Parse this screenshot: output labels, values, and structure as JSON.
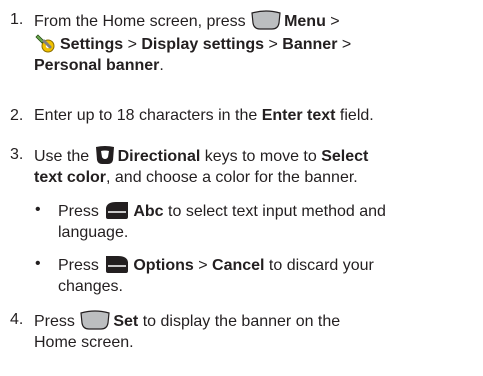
{
  "steps": [
    {
      "num": "1.",
      "a": "From the Home screen, press ",
      "b": "Menu",
      "c": " >",
      "d": "Settings",
      "e": " > ",
      "f": "Display settings",
      "g": " > ",
      "h": "Banner",
      "i": " >",
      "j": "Personal banner",
      "k": "."
    },
    {
      "num": "2.",
      "a": "Enter up to 18 characters in the ",
      "b": "Enter text",
      "c": " field."
    },
    {
      "num": "3.",
      "a": "Use the ",
      "b": "Directional",
      "c": " keys to move to ",
      "d": "Select",
      "e": "text color",
      "f": ", and choose a color for the banner."
    },
    {
      "num": "4.",
      "a": "Press ",
      "b": "Set",
      "c": " to display the banner on the",
      "d": "Home screen."
    }
  ],
  "bullets": [
    {
      "dot": "•",
      "a": "Press ",
      "b": "Abc",
      "c": " to select text input method and",
      "d": "language."
    },
    {
      "dot": "•",
      "a": "Press ",
      "b": "Options",
      "c": " > ",
      "d": "Cancel",
      "e": " to discard your",
      "f": "changes."
    }
  ],
  "icons": {
    "center-softkey": "gray rounded key",
    "settings": "wrench and gear",
    "directional": "directional pad",
    "left-softkey": "left soft key",
    "right-softkey": "right soft key",
    "key_fill": "#231f20",
    "gray_fill": "#bcbec0"
  }
}
